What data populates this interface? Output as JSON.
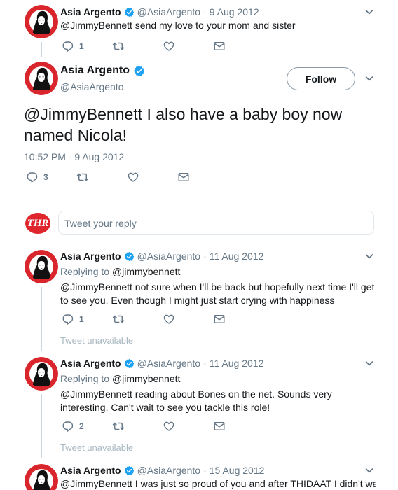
{
  "tweet1": {
    "name": "Asia Argento",
    "handle": "@AsiaArgento",
    "dot": "·",
    "date": "9 Aug 2012",
    "text": "@JimmyBennett send my love to your mom and sister",
    "reply_count": "1"
  },
  "main": {
    "name": "Asia Argento",
    "handle": "@AsiaArgento",
    "follow_label": "Follow",
    "text": "@JimmyBennett I also have a baby boy now named Nicola!",
    "timestamp": "10:52 PM - 9 Aug 2012",
    "reply_count": "3"
  },
  "reply_box": {
    "logo_text": "THR",
    "placeholder": "Tweet your reply"
  },
  "tweet2": {
    "name": "Asia Argento",
    "handle": "@AsiaArgento",
    "dot": "·",
    "date": "11 Aug 2012",
    "replying_prefix": "Replying to",
    "replying_to": "@jimmybennett",
    "text": "@JimmyBennett not sure when I'll be back but hopefully next time I'll get to see you. Even though I might just start crying with happiness",
    "reply_count": "1",
    "unavailable": "Tweet unavailable"
  },
  "tweet3": {
    "name": "Asia Argento",
    "handle": "@AsiaArgento",
    "dot": "·",
    "date": "11 Aug 2012",
    "replying_prefix": "Replying to",
    "replying_to": "@jimmybennett",
    "text": "@JimmyBennett reading about Bones on the net. Sounds very interesting. Can't wait to see you tackle this role!",
    "reply_count": "2",
    "unavailable": "Tweet unavailable"
  },
  "tweet4": {
    "name": "Asia Argento",
    "handle": "@AsiaArgento",
    "dot": "·",
    "date": "15 Aug 2012",
    "text": "@JimmyBennett I was just so proud of you and after THIDAAT I didn't want to"
  },
  "colors": {
    "verified": "#1da1f2",
    "accent": "#1da1f2",
    "muted": "#657786",
    "thr_red": "#e0262d"
  },
  "icons": [
    "reply-icon",
    "retweet-icon",
    "like-icon",
    "dm-icon",
    "caret-down-icon",
    "verified-icon"
  ]
}
